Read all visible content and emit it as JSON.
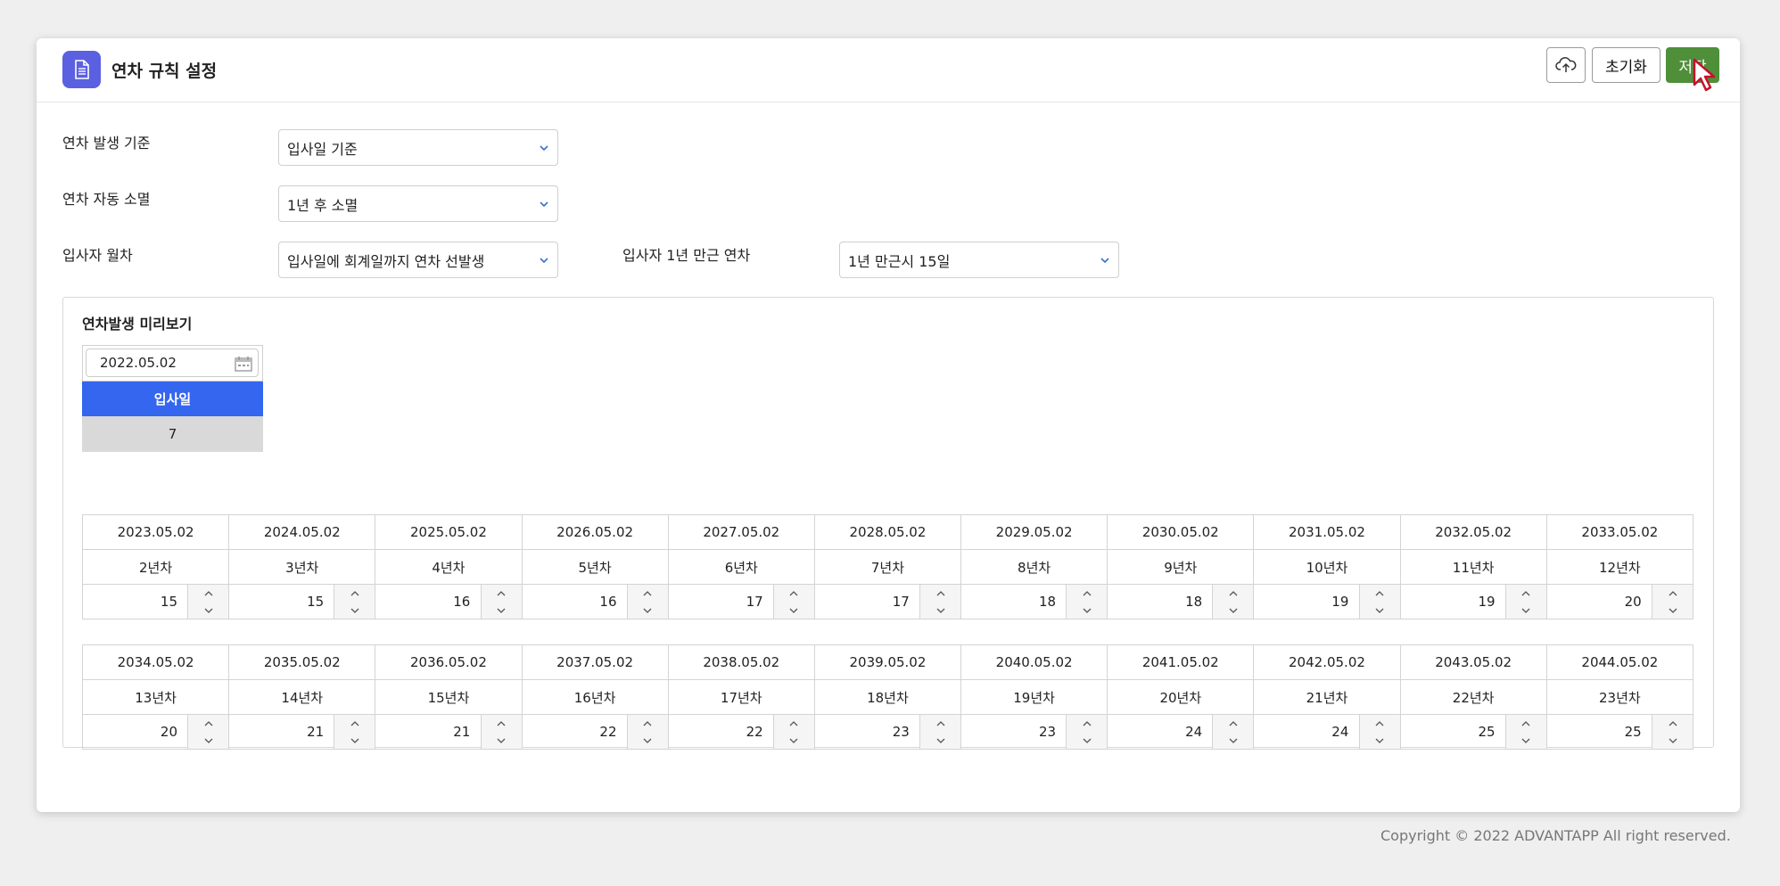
{
  "header": {
    "title": "연차 규칙 설정",
    "reset_label": "초기화",
    "save_label": "저장"
  },
  "form": {
    "occurrence_basis": {
      "label": "연차 발생 기준",
      "value": "입사일 기준"
    },
    "auto_expire": {
      "label": "연차 자동 소멸",
      "value": "1년 후 소멸"
    },
    "monthly_leave": {
      "label": "입사자 월차",
      "value": "입사일에 회계일까지 연차 선발생"
    },
    "one_year_leave": {
      "label": "입사자 1년 만근 연차",
      "value": "1년 만근시 15일"
    }
  },
  "preview": {
    "title": "연차발생 미리보기",
    "date_value": "2022.05.02",
    "hire_header": "입사일",
    "hire_value": "7",
    "rows": [
      {
        "dates": [
          "2023.05.02",
          "2024.05.02",
          "2025.05.02",
          "2026.05.02",
          "2027.05.02",
          "2028.05.02",
          "2029.05.02",
          "2030.05.02",
          "2031.05.02",
          "2032.05.02",
          "2033.05.02"
        ],
        "years": [
          "2년차",
          "3년차",
          "4년차",
          "5년차",
          "6년차",
          "7년차",
          "8년차",
          "9년차",
          "10년차",
          "11년차",
          "12년차"
        ],
        "values": [
          "15",
          "15",
          "16",
          "16",
          "17",
          "17",
          "18",
          "18",
          "19",
          "19",
          "20"
        ]
      },
      {
        "dates": [
          "2034.05.02",
          "2035.05.02",
          "2036.05.02",
          "2037.05.02",
          "2038.05.02",
          "2039.05.02",
          "2040.05.02",
          "2041.05.02",
          "2042.05.02",
          "2043.05.02",
          "2044.05.02"
        ],
        "years": [
          "13년차",
          "14년차",
          "15년차",
          "16년차",
          "17년차",
          "18년차",
          "19년차",
          "20년차",
          "21년차",
          "22년차",
          "23년차"
        ],
        "values": [
          "20",
          "21",
          "21",
          "22",
          "22",
          "23",
          "23",
          "24",
          "24",
          "25",
          "25"
        ]
      }
    ]
  },
  "footer": {
    "copyright": "Copyright © 2022 ADVANTAPP All right reserved."
  },
  "colors": {
    "accent_blue": "#3566f0",
    "save_green": "#4f8f3a",
    "icon_purple": "#5b60e0"
  }
}
